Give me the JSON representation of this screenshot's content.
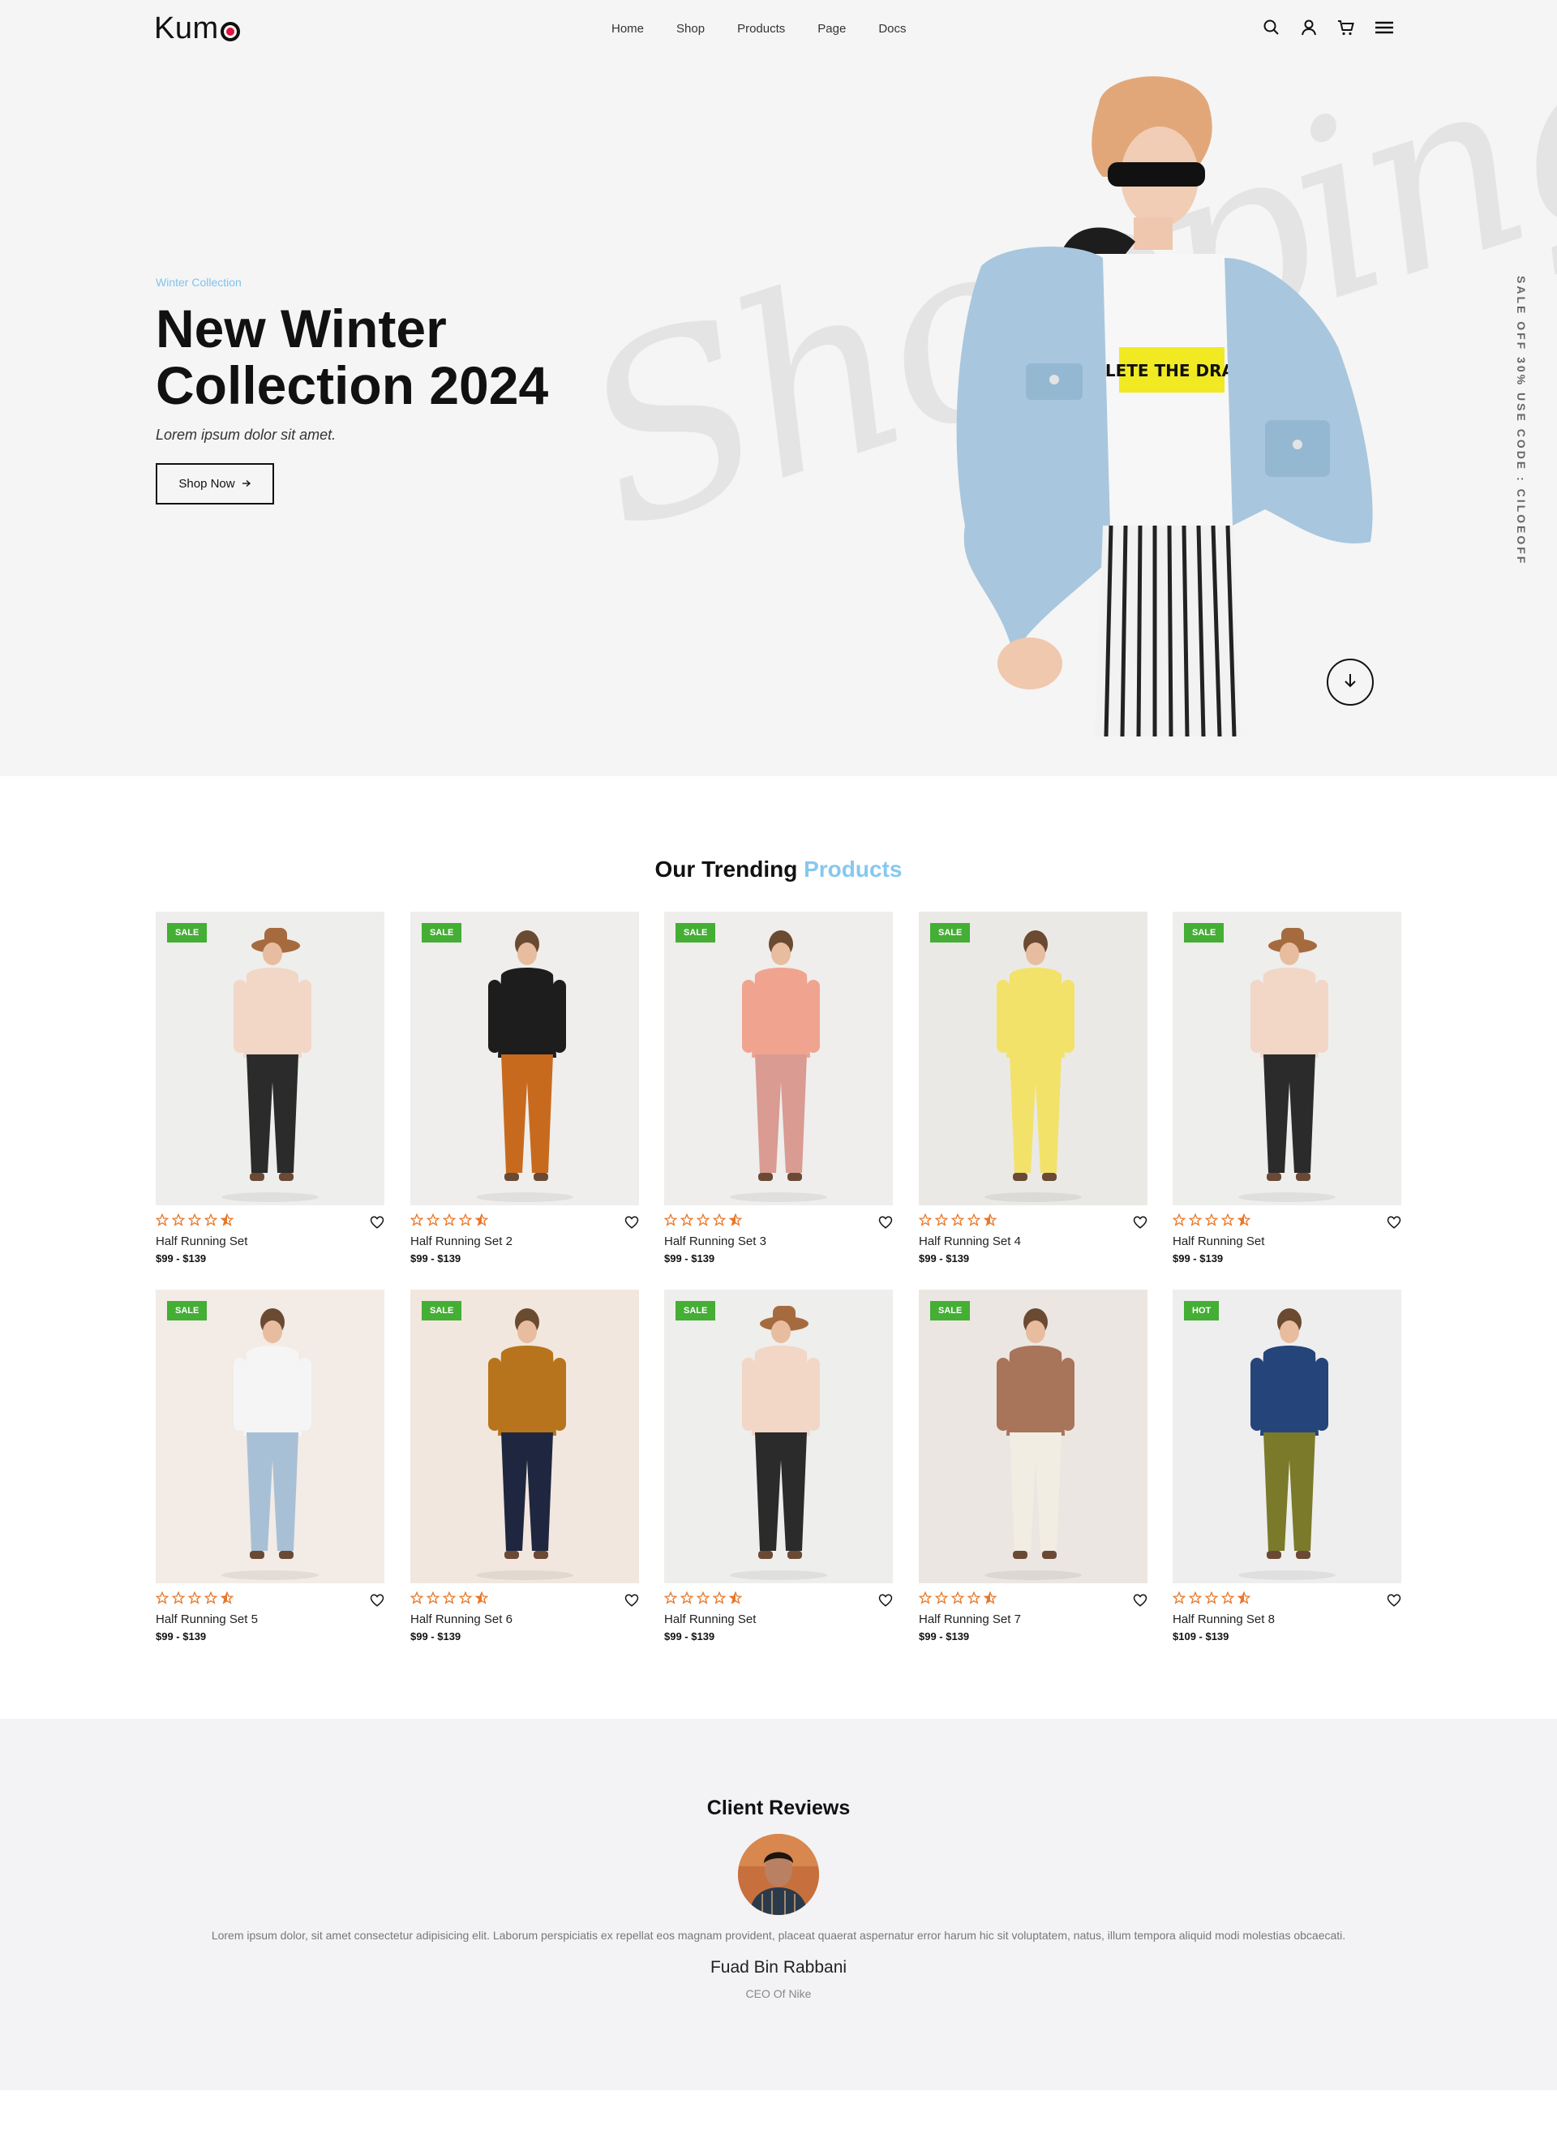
{
  "brand": {
    "logo": "Kum"
  },
  "nav": {
    "items": [
      {
        "label": "Home"
      },
      {
        "label": "Shop"
      },
      {
        "label": "Products"
      },
      {
        "label": "Page"
      },
      {
        "label": "Docs"
      }
    ],
    "icons": [
      "search-icon",
      "user-icon",
      "cart-icon",
      "menu-icon"
    ]
  },
  "hero": {
    "kicker": "Winter Collection",
    "title": "New Winter Collection 2024",
    "subtitle": "Lorem ipsum dolor sit amet.",
    "button_label": "Shop Now",
    "script_word": "Shopping",
    "tee_text": "DELETE THE DRAMA",
    "side_promo": "SALE OFF 30% USE CODE : CILOEOFF"
  },
  "trending": {
    "title_main": "Our Trending",
    "title_accent": "Products",
    "products": [
      {
        "name": "Half Running Set",
        "price": "$99 - $139",
        "badge": "SALE",
        "rating": 4.5
      },
      {
        "name": "Half Running Set 2",
        "price": "$99 - $139",
        "badge": "SALE",
        "rating": 4.5
      },
      {
        "name": "Half Running Set 3",
        "price": "$99 - $139",
        "badge": "SALE",
        "rating": 4.5
      },
      {
        "name": "Half Running Set 4",
        "price": "$99 - $139",
        "badge": "SALE",
        "rating": 4.5
      },
      {
        "name": "Half Running Set",
        "price": "$99 - $139",
        "badge": "SALE",
        "rating": 4.5
      },
      {
        "name": "Half Running Set 5",
        "price": "$99 - $139",
        "badge": "SALE",
        "rating": 4.5
      },
      {
        "name": "Half Running Set 6",
        "price": "$99 - $139",
        "badge": "SALE",
        "rating": 4.5
      },
      {
        "name": "Half Running Set",
        "price": "$99 - $139",
        "badge": "SALE",
        "rating": 4.5
      },
      {
        "name": "Half Running Set 7",
        "price": "$99 - $139",
        "badge": "SALE",
        "rating": 4.5
      },
      {
        "name": "Half Running Set 8",
        "price": "$109 - $139",
        "badge": "HOT",
        "rating": 4.5
      }
    ]
  },
  "reviews": {
    "title": "Client Reviews",
    "text": "Lorem ipsum dolor, sit amet consectetur adipisicing elit. Laborum perspiciatis ex repellat eos magnam provident, placeat quaerat aspernatur error harum hic sit voluptatem, natus, illum tempora aliquid modi molestias obcaecati.",
    "name": "Fuad Bin Rabbani",
    "role": "CEO Of Nike"
  },
  "colors": {
    "accent": "#86c8ee",
    "badge": "#44ae35",
    "star": "#e8782a",
    "logo_dot": "#e2133c"
  }
}
